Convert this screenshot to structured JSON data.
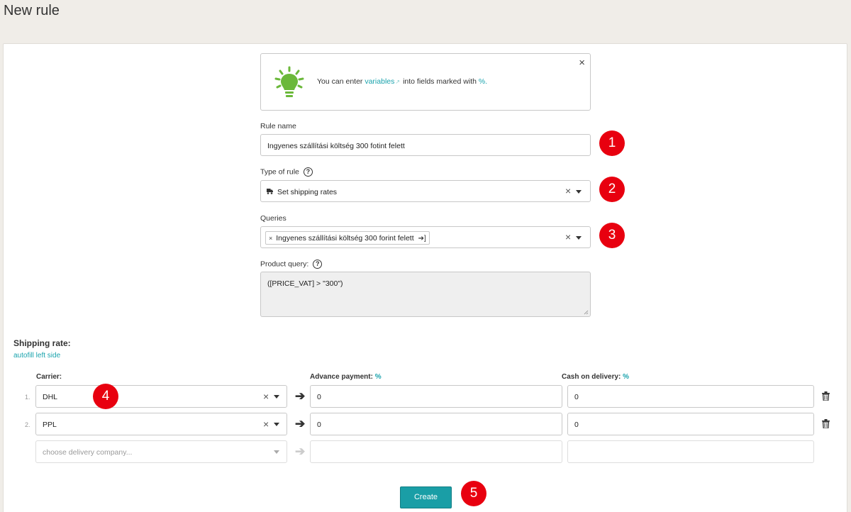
{
  "page": {
    "title": "New rule"
  },
  "info": {
    "text_before": "You can enter",
    "link": "variables",
    "text_after": "into fields marked with",
    "symbol": "%.",
    "close": "×"
  },
  "rule_name": {
    "label": "Rule name",
    "value": "Ingyenes szállítási költség 300 fotint felett"
  },
  "type_of_rule": {
    "label": "Type of rule",
    "help": "?",
    "icon": "truck-icon",
    "value": "Set shipping rates",
    "clear": "×"
  },
  "queries": {
    "label": "Queries",
    "tag": "Ingyenes szállítási költség 300 forint felett",
    "tag_remove": "×",
    "tag_go": "➔]",
    "clear": "×"
  },
  "product_query": {
    "label": "Product query:",
    "help": "?",
    "value": "([PRICE_VAT] > \"300\")"
  },
  "shipping": {
    "title": "Shipping rate:",
    "autofill": "autofill left side",
    "headers": {
      "carrier": "Carrier:",
      "advance": "Advance payment:",
      "cod": "Cash on delivery:",
      "percent": "%"
    },
    "rows": [
      {
        "num": "1.",
        "carrier": "DHL",
        "advance": "0",
        "cod": "0"
      },
      {
        "num": "2.",
        "carrier": "PPL",
        "advance": "0",
        "cod": "0"
      }
    ],
    "new_row_placeholder": "choose delivery company...",
    "arrow": "➔",
    "clear": "×"
  },
  "create_button": "Create",
  "badges": [
    "1",
    "2",
    "3",
    "4",
    "5"
  ],
  "colors": {
    "accent": "#1a9ea6",
    "badge": "#e8000f",
    "bulb": "#6bb83a"
  }
}
